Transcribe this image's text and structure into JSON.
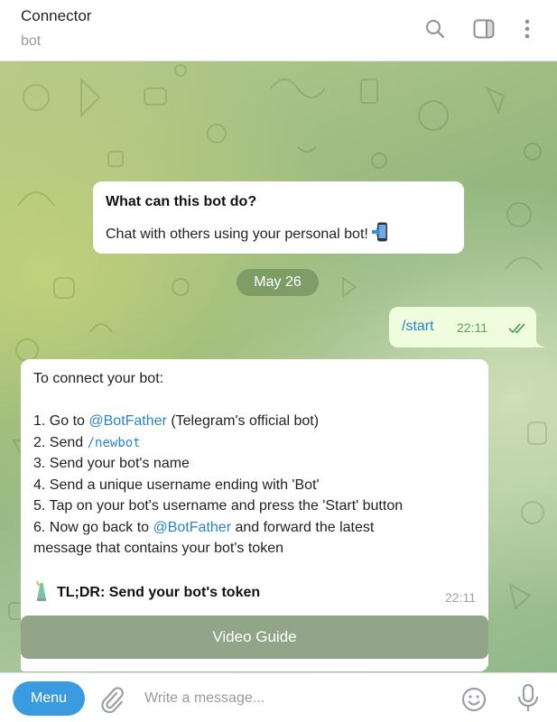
{
  "header": {
    "title": "Connector",
    "subtitle": "bot",
    "icons": [
      "search-icon",
      "sidebar-toggle-icon",
      "more-vertical-icon"
    ]
  },
  "chat": {
    "intro": {
      "heading": "What can this bot do?",
      "text": "Chat with others using your personal bot!",
      "emoji": "phone-arrow-icon"
    },
    "date": "May 26",
    "outgoing": {
      "text": "/start",
      "time": "22:11",
      "status": "read-double-check"
    },
    "incoming": {
      "intro": "To connect your bot:",
      "step1_prefix": "1. Go to ",
      "step1_link": "@BotFather",
      "step1_suffix": " (Telegram's official bot)",
      "step2_prefix": "2. Send ",
      "step2_code": "/newbot",
      "step3": "3. Send your bot's name",
      "step4": "4. Send a unique username ending with 'Bot'",
      "step5": "5. Tap on your bot's username and press the 'Start' button",
      "step6_prefix": "6. Now go back to ",
      "step6_link": "@BotFather",
      "step6_suffix": " and forward the latest",
      "step6_line2": "message that contains your bot's token",
      "tldr": "TL;DR: Send your bot's token",
      "time": "22:11"
    },
    "button": "Video Guide"
  },
  "composer": {
    "menu_label": "Menu",
    "placeholder": "Write a message..."
  },
  "colors": {
    "accent": "#3a9be0",
    "link": "#2a83c8",
    "outgoing_bubble": "#effdde",
    "read_ticks": "#5aa25a"
  }
}
